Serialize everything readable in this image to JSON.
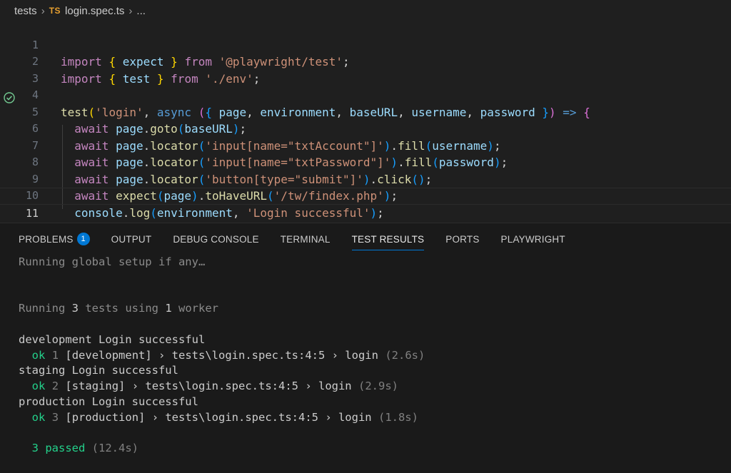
{
  "breadcrumb": {
    "folder": "tests",
    "file_badge": "TS",
    "file": "login.spec.ts",
    "ellipsis": "..."
  },
  "editor": {
    "line_numbers": [
      "1",
      "2",
      "3",
      "4",
      "5",
      "6",
      "7",
      "8",
      "9",
      "10",
      "11"
    ],
    "lines": [
      "import { expect } from '@playwright/test';",
      "import { test } from './env';",
      "",
      "test('login', async ({ page, environment, baseURL, username, password }) => {",
      "  await page.goto(baseURL);",
      "  await page.locator('input[name=\"txtAccount\"]').fill(username);",
      "  await page.locator('input[name=\"txtPassword\"]').fill(password);",
      "  await page.locator('button[type=\"submit\"]').click();",
      "  await expect(page).toHaveURL('/tw/findex.php');",
      "  console.log(environment, 'Login successful');",
      "});"
    ]
  },
  "panel": {
    "tabs": [
      {
        "label": "PROBLEMS",
        "badge": "1"
      },
      {
        "label": "OUTPUT"
      },
      {
        "label": "DEBUG CONSOLE"
      },
      {
        "label": "TERMINAL"
      },
      {
        "label": "TEST RESULTS",
        "active": true
      },
      {
        "label": "PORTS"
      },
      {
        "label": "PLAYWRIGHT"
      }
    ],
    "output": {
      "global_setup": "Running global setup if any…",
      "running": {
        "prefix": "Running ",
        "count": "3",
        "mid": " tests using ",
        "workers": "1",
        "suffix": " worker"
      },
      "results": [
        {
          "log": "development Login successful",
          "ok": "ok",
          "num": "1",
          "detail": "[development] › tests\\login.spec.ts:4:5 › login",
          "time": "(2.6s)"
        },
        {
          "log": "staging Login successful",
          "ok": "ok",
          "num": "2",
          "detail": "[staging] › tests\\login.spec.ts:4:5 › login",
          "time": "(2.9s)"
        },
        {
          "log": "production Login successful",
          "ok": "ok",
          "num": "3",
          "detail": "[production] › tests\\login.spec.ts:4:5 › login",
          "time": "(1.8s)"
        }
      ],
      "summary": {
        "passed": "3 passed",
        "time": "(12.4s)"
      }
    }
  },
  "colors": {
    "accent": "#0078d4",
    "ok": "#23d18b",
    "ts_badge": "#e8a02f"
  }
}
